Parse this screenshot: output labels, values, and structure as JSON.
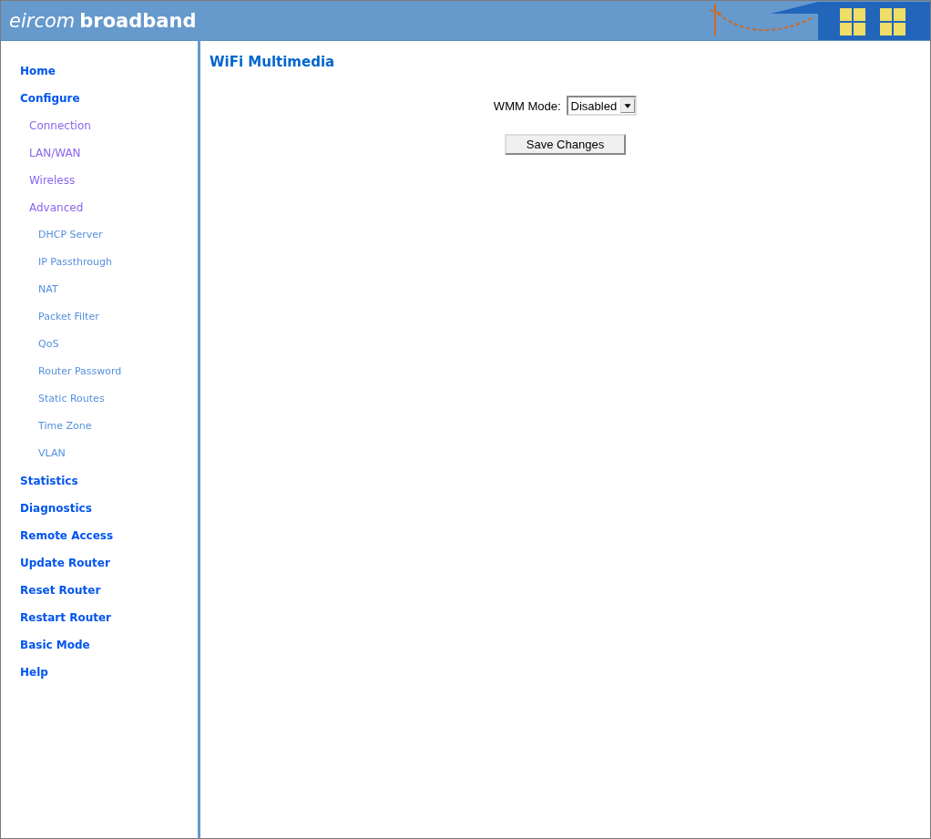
{
  "header": {
    "brand": "eircom",
    "product": "broadband"
  },
  "sidebar": {
    "items": [
      {
        "label": "Home"
      },
      {
        "label": "Configure",
        "children": [
          {
            "label": "Connection"
          },
          {
            "label": "LAN/WAN"
          },
          {
            "label": "Wireless"
          },
          {
            "label": "Advanced",
            "children": [
              {
                "label": "DHCP Server"
              },
              {
                "label": "IP Passthrough"
              },
              {
                "label": "NAT"
              },
              {
                "label": "Packet Filter"
              },
              {
                "label": "QoS"
              },
              {
                "label": "Router Password"
              },
              {
                "label": "Static Routes"
              },
              {
                "label": "Time Zone"
              },
              {
                "label": "VLAN"
              }
            ]
          }
        ]
      },
      {
        "label": "Statistics"
      },
      {
        "label": "Diagnostics"
      },
      {
        "label": "Remote Access"
      },
      {
        "label": "Update Router"
      },
      {
        "label": "Reset Router"
      },
      {
        "label": "Restart Router"
      },
      {
        "label": "Basic Mode"
      },
      {
        "label": "Help"
      }
    ]
  },
  "content": {
    "title": "WiFi Multimedia",
    "field_label": "WMM Mode:",
    "select_value": "Disabled",
    "button": "Save Changes"
  }
}
